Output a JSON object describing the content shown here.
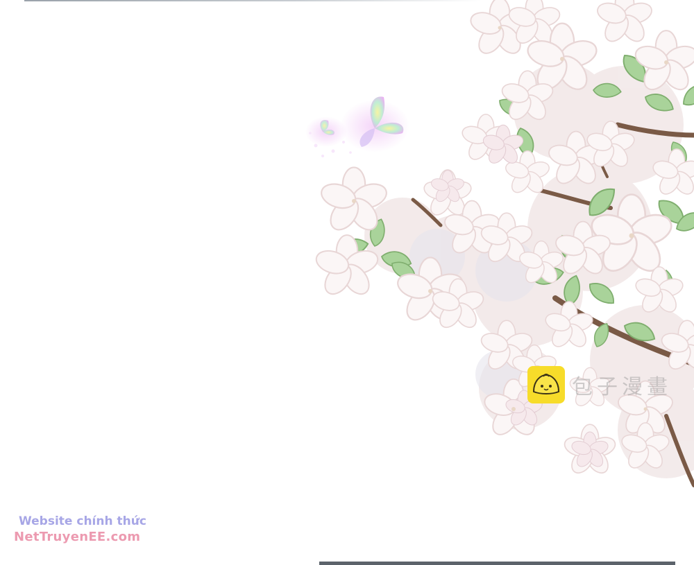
{
  "watermark": {
    "logo_icon": "bun-mascot-icon",
    "text": "包子漫畫"
  },
  "site_promo": {
    "line1": "Website chính thức",
    "line2": "NetTruyenEE.com"
  },
  "illustration": {
    "subject_icon": "cherry-blossom-branch-icon",
    "butterfly_icon": "butterfly-icon"
  },
  "colors": {
    "background": "#ffffff",
    "promo_line1": "#a7a6e6",
    "promo_line2": "#ec9ab0",
    "logo_bg": "#f7dc2a",
    "leaf": "#a9d39a",
    "petal": "#f3e6e6",
    "branch": "#7a5a46"
  }
}
